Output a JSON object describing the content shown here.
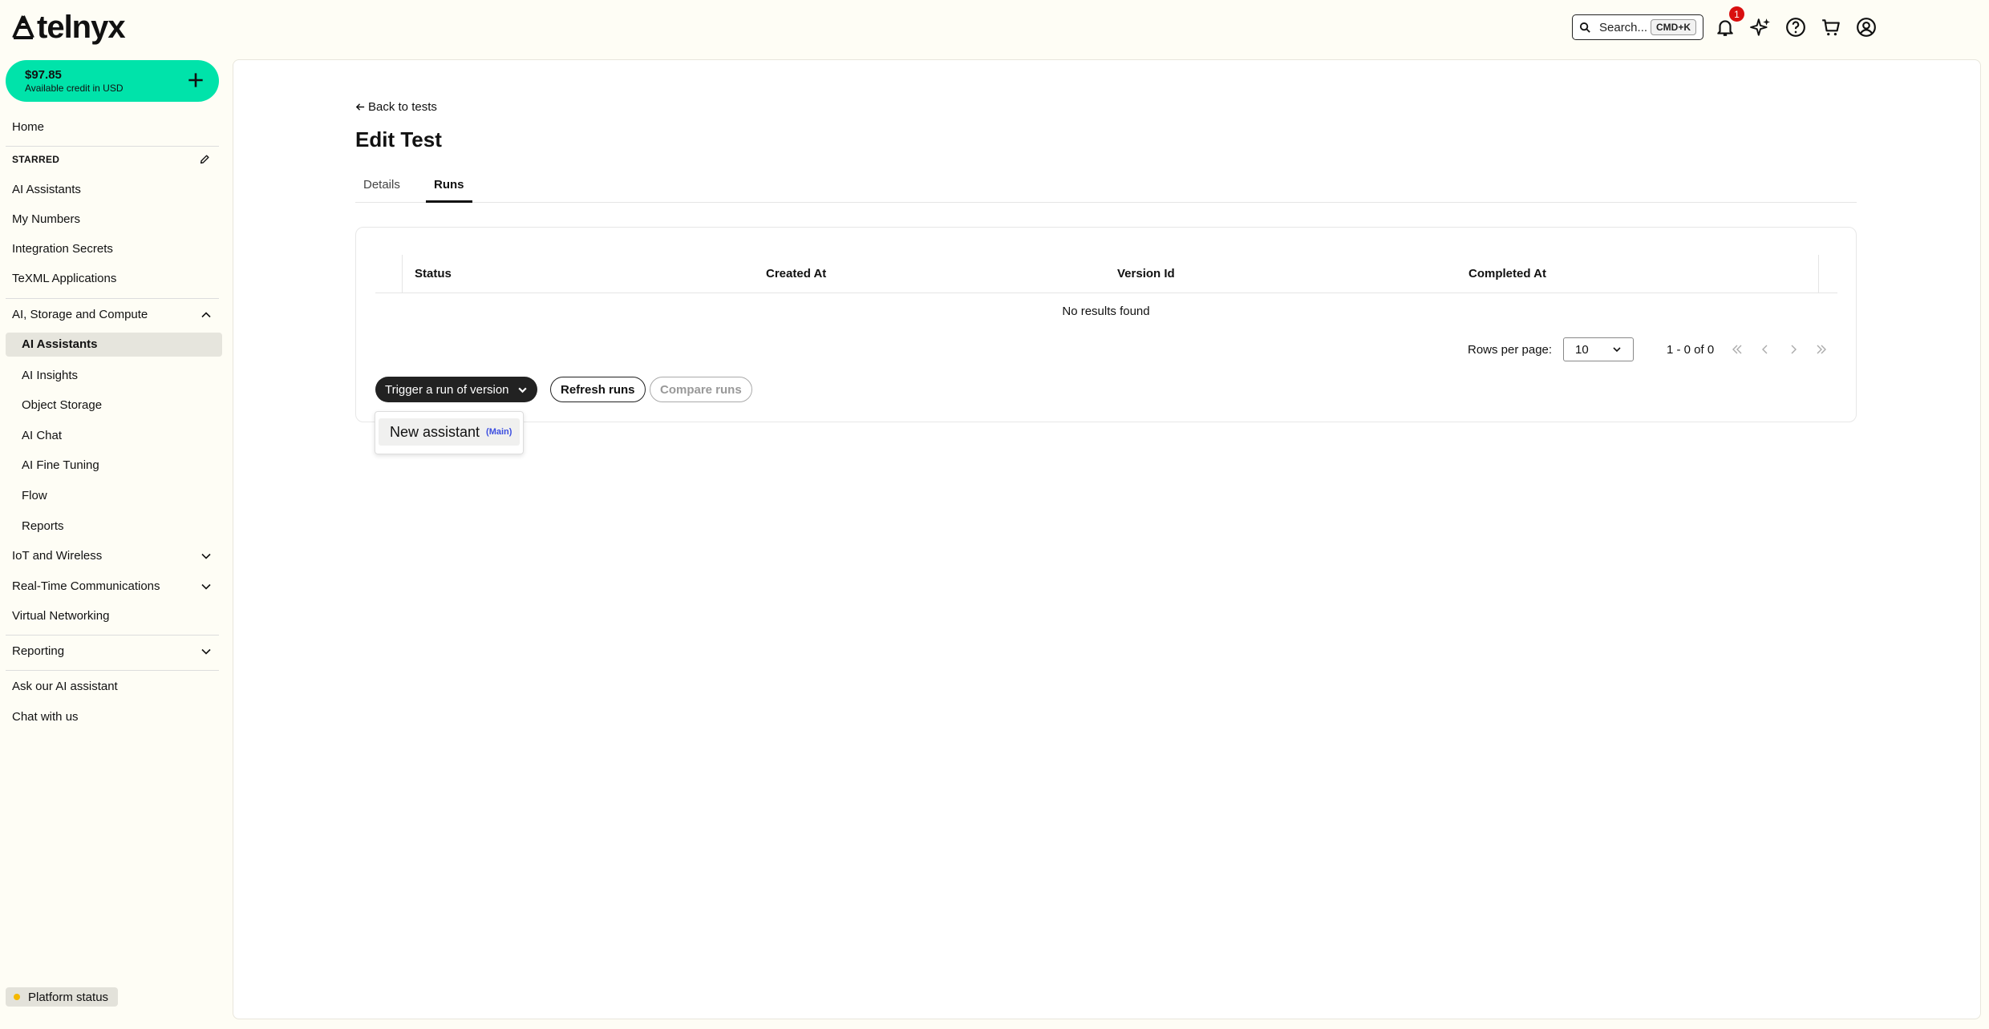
{
  "brand": {
    "name": "telnyx"
  },
  "header": {
    "search_label": "Search...",
    "search_shortcut": "CMD+K",
    "notification_count": "1"
  },
  "sidebar": {
    "credit_amount": "$97.85",
    "credit_label": "Available credit in USD",
    "home": "Home",
    "starred_label": "STARRED",
    "starred": [
      "AI Assistants",
      "My Numbers",
      "Integration Secrets",
      "TeXML Applications"
    ],
    "ai_group": "AI, Storage and Compute",
    "ai_items": [
      "AI Assistants",
      "AI Insights",
      "Object Storage",
      "AI Chat",
      "AI Fine Tuning",
      "Flow",
      "Reports"
    ],
    "iot": "IoT and Wireless",
    "rtc": "Real-Time Communications",
    "vnet": "Virtual Networking",
    "reporting": "Reporting",
    "ask_ai": "Ask our AI assistant",
    "chat": "Chat with us",
    "platform_status": "Platform status"
  },
  "main": {
    "back_link": "Back to tests",
    "title": "Edit Test",
    "tabs": [
      {
        "label": "Details",
        "active": false
      },
      {
        "label": "Runs",
        "active": true
      }
    ],
    "table": {
      "columns": [
        "Status",
        "Created At",
        "Version Id",
        "Completed At"
      ],
      "empty_message": "No results found"
    },
    "pagination": {
      "rows_label": "Rows per page:",
      "rows_value": "10",
      "range": "1 - 0 of 0"
    },
    "actions": {
      "trigger": "Trigger a run of version",
      "refresh": "Refresh runs",
      "compare": "Compare runs"
    },
    "dropdown": {
      "item_label": "New assistant",
      "item_tag": "(Main)"
    }
  },
  "colors": {
    "accent": "#00e3aa",
    "background": "#fefdf5",
    "badge": "#d90f0f"
  }
}
